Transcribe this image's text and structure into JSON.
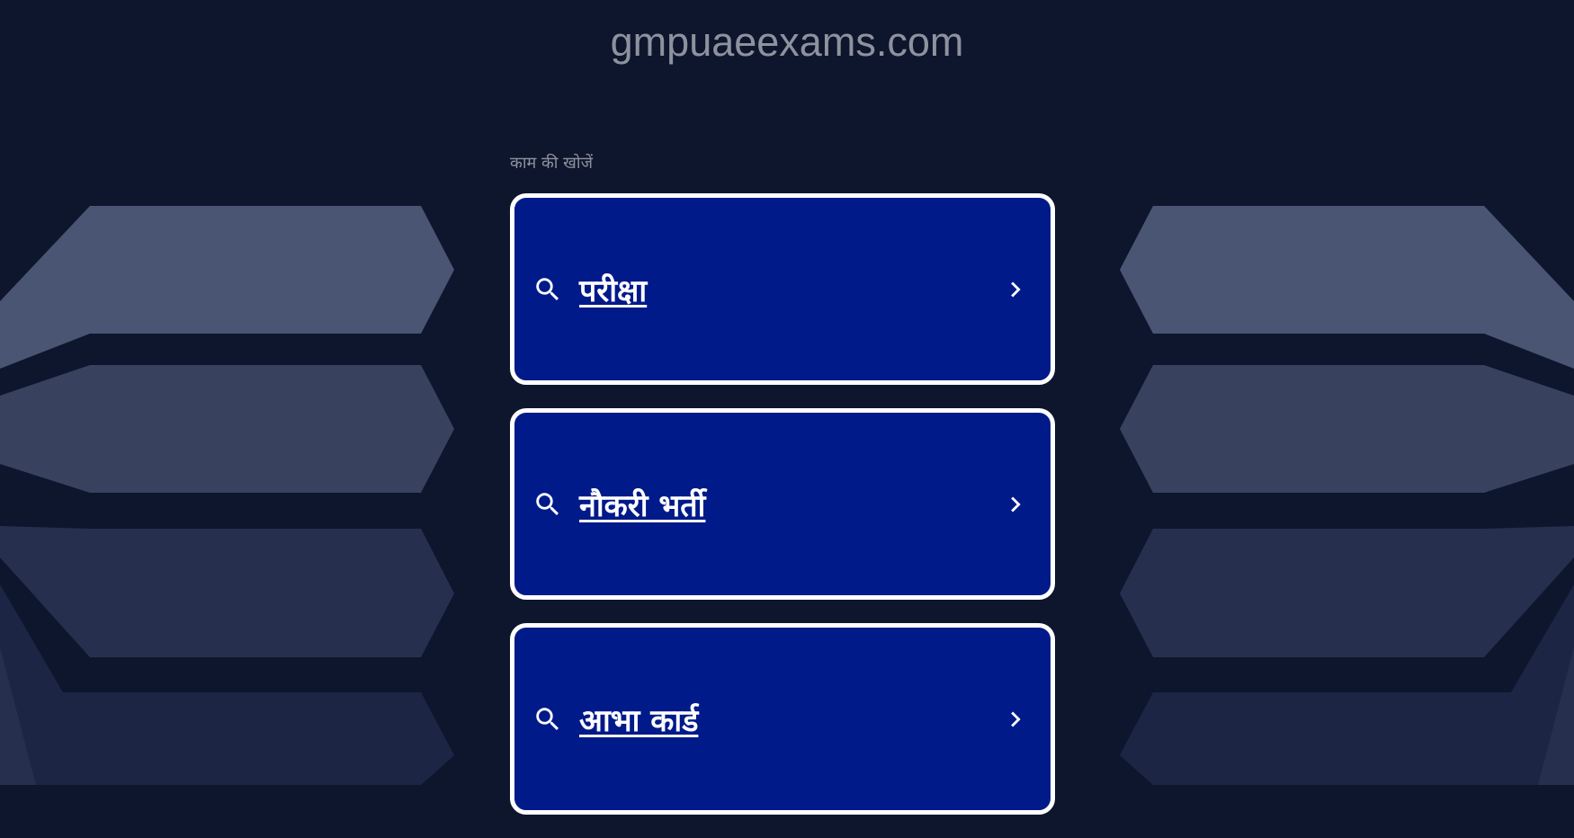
{
  "header": {
    "domain": "gmpuaeexams.com"
  },
  "search": {
    "label": "काम की खोजें"
  },
  "results": [
    {
      "label": "परीक्षा",
      "icon": "search-icon"
    },
    {
      "label": "नौकरी भर्ती",
      "icon": "search-icon"
    },
    {
      "label": "आभा कार्ड",
      "icon": "search-icon"
    }
  ],
  "colors": {
    "background": "#0e162e",
    "card": "#001a8a",
    "card_border": "#ffffff",
    "muted_text": "#8e929e"
  }
}
